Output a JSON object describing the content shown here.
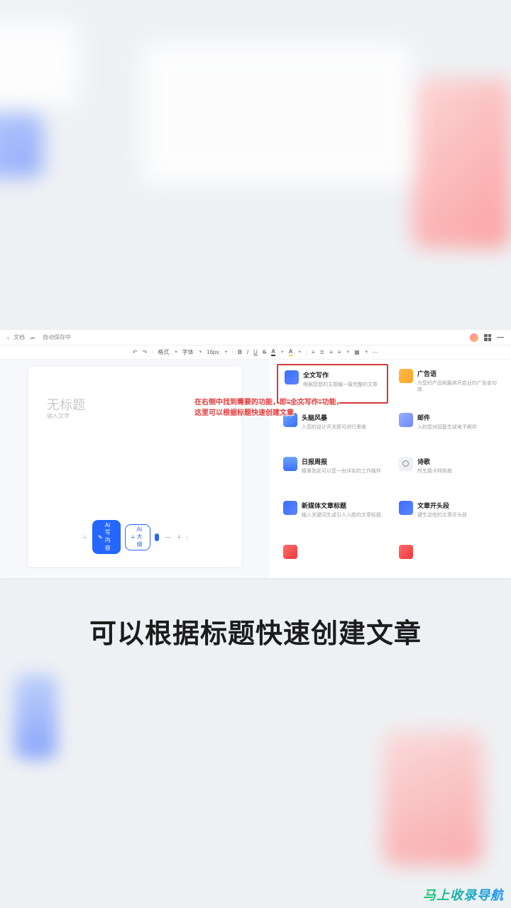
{
  "titlebar": {
    "doc_name": "文档",
    "sync_status": "自动保存中"
  },
  "toolbar": {
    "undo": "↶",
    "redo": "↷",
    "format_painter": "格式",
    "font": "字体",
    "size_label": "16px",
    "bold": "B",
    "italic": "I",
    "underline": "U",
    "strike": "S",
    "color": "A",
    "highlight": "A"
  },
  "canvas": {
    "title_placeholder": "无标题",
    "body_placeholder": "输入文字"
  },
  "ai_bar": {
    "btn1": "AI写内容",
    "btn2": "AI大纲",
    "m1": "—",
    "m2": "＋"
  },
  "templates": [
    {
      "title": "全文写作",
      "desc": "根据您想的主题编一篇完整的文章"
    },
    {
      "title": "广告语",
      "desc": "为您的产品和服务开启业的广告金句库"
    },
    {
      "title": "头脑风暴",
      "desc": "入您的设计开关即可进行思维"
    },
    {
      "title": "邮件",
      "desc": "入的您对回复生成电子邮件"
    },
    {
      "title": "日报周报",
      "desc": "精事到此可以您一份详实的工作报件"
    },
    {
      "title": "诗歌",
      "desc": "所生题卡特色歌"
    },
    {
      "title": "新媒体文章标题",
      "desc": "输入关键词生成引人入胜的文章标题"
    },
    {
      "title": "文章开头段",
      "desc": "键生动完的文章开头段"
    }
  ],
  "annotation": {
    "line1": "在右侧中找到需要的功能，即\"全文写作\"功能，",
    "line2": "这里可以根据标题快速创建文章"
  },
  "caption": "可以根据标题快速创建文章",
  "watermark": "马上收录导航"
}
